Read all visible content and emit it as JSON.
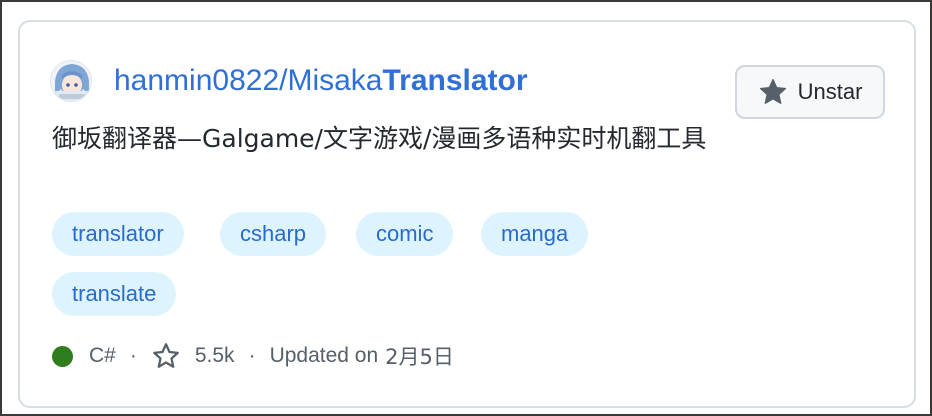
{
  "repo": {
    "owner": "hanmin0822/Misaka",
    "name": "Translator",
    "description": "御坂翻译器—Galgame/文字游戏/漫画多语种实时机翻工具"
  },
  "star_button": {
    "label": "Unstar",
    "icon": "star-filled-icon"
  },
  "topics": [
    "translator",
    "csharp",
    "comic",
    "manga",
    "translate"
  ],
  "meta": {
    "language": "C#",
    "language_color": "#2f7d1c",
    "separator": "·",
    "stars": "5.5k",
    "updated_prefix": "Updated on",
    "updated_date": "2月5日"
  },
  "colors": {
    "link": "#2f6fd6",
    "topic_bg": "#ddf4ff",
    "topic_text": "#2a6acb"
  }
}
